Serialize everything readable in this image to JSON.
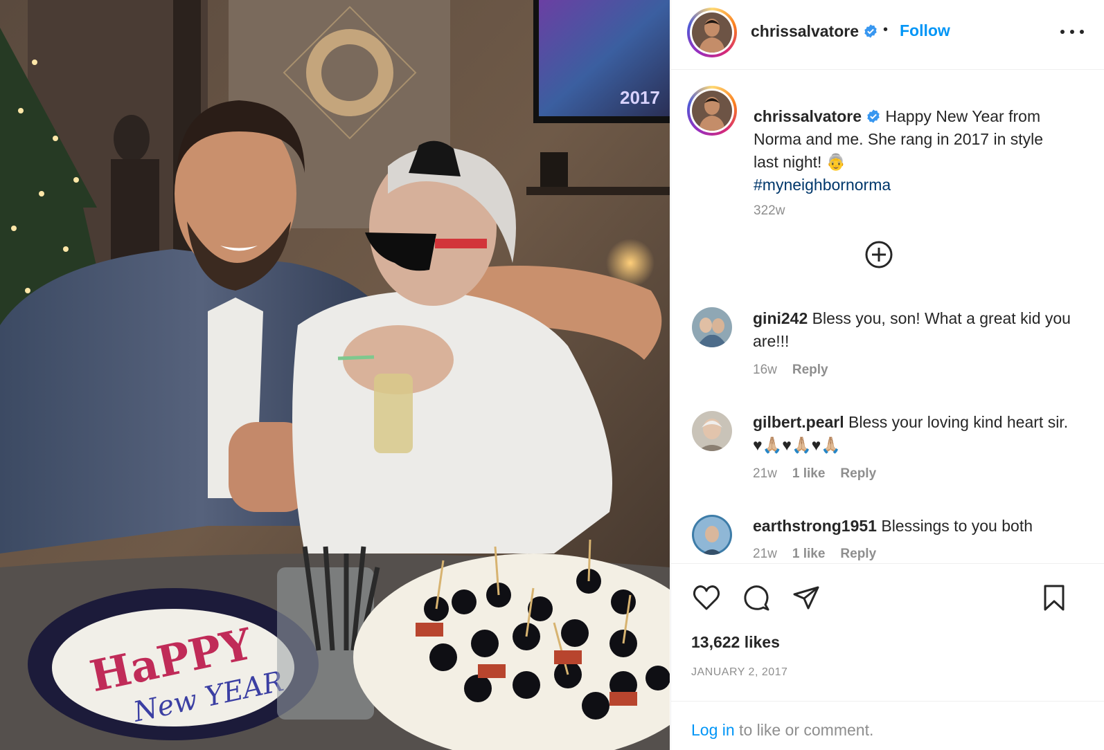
{
  "post": {
    "username": "chrissalvatore",
    "follow_label": "Follow",
    "dot": "•"
  },
  "caption": {
    "username": "chrissalvatore",
    "text": "Happy New Year from Norma and me. She rang in 2017 in style last night! 👵",
    "hashtag": "#myneighbornorma",
    "time": "322w"
  },
  "comments": [
    {
      "username": "gini242",
      "text": "Bless you, son! What a great kid you are!!!",
      "time": "16w",
      "likes": "",
      "reply": "Reply"
    },
    {
      "username": "gilbert.pearl",
      "text": "Bless your loving kind heart sir. ♥🙏🏼♥🙏🏼♥🙏🏼",
      "time": "21w",
      "likes": "1 like",
      "reply": "Reply"
    },
    {
      "username": "earthstrong1951",
      "text": "Blessings to you both",
      "time": "21w",
      "likes": "1 like",
      "reply": "Reply"
    }
  ],
  "footer": {
    "likes": "13,622 likes",
    "date": "JANUARY 2, 2017",
    "login_link": "Log in",
    "login_rest": " to like or comment."
  },
  "photo": {
    "plate_line1": "HaPPY",
    "plate_line2": "New YEAR",
    "tv_text": "2017"
  },
  "icons": [
    "verified-badge-icon",
    "more-options-icon",
    "add-comment-icon",
    "heart-icon",
    "comment-icon",
    "share-icon",
    "bookmark-icon"
  ],
  "colors": {
    "accent": "#0095f6",
    "hashtag": "#00376b",
    "secondary_text": "#8e8e8e"
  }
}
